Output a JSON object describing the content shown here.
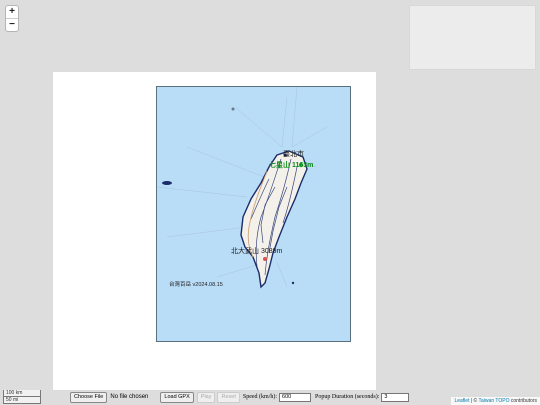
{
  "zoom": {
    "in_label": "+",
    "out_label": "−"
  },
  "map": {
    "labels": {
      "city_north": "臺北市",
      "peak_north": "七星山 1163m",
      "peak_south": "北大武山 3089m",
      "version": "台灣百岳 v2024.08.15"
    }
  },
  "scale": {
    "km": "100 km",
    "mi": "50 mi"
  },
  "controls": {
    "choose_file": "Choose File",
    "no_file": "No file chosen",
    "load_gpx": "Load GPX",
    "play": "Play",
    "reset": "Reset",
    "speed_label": "Speed (km/h):",
    "speed_value": "600",
    "popup_label": "Popup Duration (seconds):",
    "popup_value": "3"
  },
  "attribution": {
    "leaflet": "Leaflet",
    "sep": " | © ",
    "provider": "Taiwan TOPO",
    "suffix": " contributors"
  }
}
